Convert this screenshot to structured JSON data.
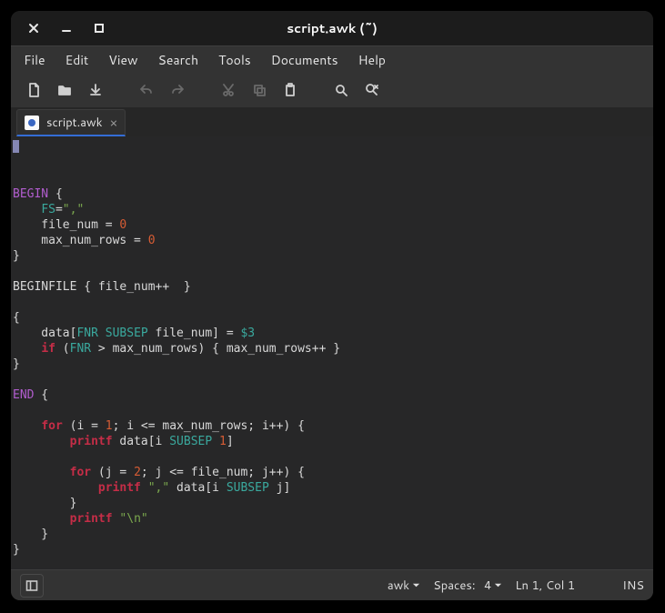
{
  "window": {
    "title": "script.awk (~)"
  },
  "menubar": [
    "File",
    "Edit",
    "View",
    "Search",
    "Tools",
    "Documents",
    "Help"
  ],
  "tabs": [
    {
      "label": "script.awk"
    }
  ],
  "status": {
    "language": "awk",
    "indent_label": "Spaces:",
    "indent_width": "4",
    "cursor": "Ln 1, Col 1",
    "mode": "INS"
  },
  "code": {
    "tokens": [
      [
        {
          "t": "BEGIN",
          "c": "kw1"
        },
        {
          "t": " {"
        }
      ],
      [
        {
          "t": "    "
        },
        {
          "t": "FS",
          "c": "var"
        },
        {
          "t": "="
        },
        {
          "t": "\",\"",
          "c": "str"
        }
      ],
      [
        {
          "t": "    file_num = "
        },
        {
          "t": "0",
          "c": "num"
        }
      ],
      [
        {
          "t": "    max_num_rows = "
        },
        {
          "t": "0",
          "c": "num"
        }
      ],
      [
        {
          "t": "}"
        }
      ],
      [],
      [
        {
          "t": "BEGINFILE { file_num++  }"
        }
      ],
      [],
      [
        {
          "t": "{"
        }
      ],
      [
        {
          "t": "    data["
        },
        {
          "t": "FNR",
          "c": "var"
        },
        {
          "t": " "
        },
        {
          "t": "SUBSEP",
          "c": "var"
        },
        {
          "t": " file_num] = "
        },
        {
          "t": "$3",
          "c": "var"
        }
      ],
      [
        {
          "t": "    "
        },
        {
          "t": "if",
          "c": "kw2"
        },
        {
          "t": " ("
        },
        {
          "t": "FNR",
          "c": "var"
        },
        {
          "t": " > max_num_rows) { max_num_rows++ }"
        }
      ],
      [
        {
          "t": "}"
        }
      ],
      [],
      [
        {
          "t": "END",
          "c": "kw1"
        },
        {
          "t": " {"
        }
      ],
      [],
      [
        {
          "t": "    "
        },
        {
          "t": "for",
          "c": "kw2"
        },
        {
          "t": " (i = "
        },
        {
          "t": "1",
          "c": "num"
        },
        {
          "t": "; i <= max_num_rows; i++) {"
        }
      ],
      [
        {
          "t": "        "
        },
        {
          "t": "printf",
          "c": "kw2"
        },
        {
          "t": " data[i "
        },
        {
          "t": "SUBSEP",
          "c": "var"
        },
        {
          "t": " "
        },
        {
          "t": "1",
          "c": "num"
        },
        {
          "t": "]"
        }
      ],
      [],
      [
        {
          "t": "        "
        },
        {
          "t": "for",
          "c": "kw2"
        },
        {
          "t": " (j = "
        },
        {
          "t": "2",
          "c": "num"
        },
        {
          "t": "; j <= file_num; j++) {"
        }
      ],
      [
        {
          "t": "            "
        },
        {
          "t": "printf",
          "c": "kw2"
        },
        {
          "t": " "
        },
        {
          "t": "\",\"",
          "c": "str"
        },
        {
          "t": " data[i "
        },
        {
          "t": "SUBSEP",
          "c": "var"
        },
        {
          "t": " j]"
        }
      ],
      [
        {
          "t": "        }"
        }
      ],
      [
        {
          "t": "        "
        },
        {
          "t": "printf",
          "c": "kw2"
        },
        {
          "t": " "
        },
        {
          "t": "\"\\n\"",
          "c": "str"
        }
      ],
      [
        {
          "t": "    }"
        }
      ],
      [
        {
          "t": "}"
        }
      ]
    ]
  }
}
